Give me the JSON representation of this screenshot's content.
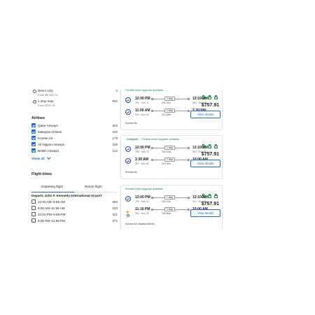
{
  "sidebar": {
    "stops": [
      {
        "label": "Direct only",
        "count": "4",
        "from": "From $1,105.73"
      },
      {
        "label": "1 stop max",
        "count": "692",
        "from": "From $757.91"
      }
    ],
    "airlines_heading": "Airlines",
    "airlines": [
      {
        "label": "Qatar Airways",
        "count": "203",
        "checked": true
      },
      {
        "label": "Malaysia Airlines",
        "count": "192",
        "checked": true
      },
      {
        "label": "Korean Air",
        "count": "179",
        "checked": true
      },
      {
        "label": "All Nippon Airways",
        "count": "119",
        "checked": true
      },
      {
        "label": "British Airways",
        "count": "112",
        "checked": true
      }
    ],
    "show_all": "Show all",
    "flight_times_heading": "Flight times",
    "tabs": [
      "Departing flight",
      "Return flight"
    ],
    "departs_heading": "Departs John F. Kennedy International Airport",
    "times": [
      {
        "label": "12:00 AM–5:59 AM",
        "count": "393"
      },
      {
        "label": "6:00 AM–11:59 AM",
        "count": "223"
      },
      {
        "label": "12:00 PM–5:59 PM",
        "count": "321"
      },
      {
        "label": "6:00 PM–11:59 PM",
        "count": "371"
      }
    ]
  },
  "results": [
    {
      "badge": "Flexible ticket upgrade available",
      "cheapest": "",
      "legs": [
        {
          "dep": "12:00 PM",
          "dep_sub": "JFK · Nov 11",
          "stop": "1 stop",
          "dur": "23h 10m",
          "arr": "12:10 AM",
          "arr_sub": "SIN · Nov 13"
        },
        {
          "dep": "11:00 AM",
          "dep_sub": "SIN · Nov 18",
          "stop": "1 stop",
          "dur": "21h 45m",
          "arr": "7:30 PM",
          "arr_sub": "JFK · Nov 18"
        }
      ],
      "airline": "Korean Air",
      "price": "$757.91",
      "button": "View details"
    },
    {
      "badge": "Flexible ticket upgrade available",
      "cheapest": "Cheapest",
      "legs": [
        {
          "dep": "12:00 PM",
          "dep_sub": "JFK · Nov 11",
          "stop": "1 stop",
          "dur": "23h 10m",
          "arr": "12:10 AM",
          "arr_sub": "SIN · Nov 13"
        },
        {
          "dep": "1:30 AM",
          "dep_sub": "SIN · Nov 18",
          "stop": "1 stop",
          "dur": "21h 30m",
          "arr": "10:00 AM",
          "arr_sub": "JFK · Nov 18"
        }
      ],
      "airline": "Korean Air",
      "price": "$757.91",
      "button": "View details"
    },
    {
      "badge": "Flexible ticket upgrade available",
      "cheapest": "",
      "legs": [
        {
          "dep": "12:00 PM",
          "dep_sub": "JFK · Nov 11",
          "stop": "1 stop",
          "dur": "23h 10m",
          "arr": "12:10 AM",
          "arr_sub": "SIN · Nov 13"
        },
        {
          "dep": "11:10 PM",
          "dep_sub": "SIN · Nov 18",
          "stop": "1 stop",
          "dur": "23h 50m",
          "arr": "10:00 AM",
          "arr_sub": "JFK · Nov 19"
        }
      ],
      "airline": "Korean Air, Asiana Airlines",
      "price": "$757.91",
      "button": "View details"
    }
  ],
  "colors": {
    "accent": "#1e68c9",
    "green": "#14803c"
  }
}
